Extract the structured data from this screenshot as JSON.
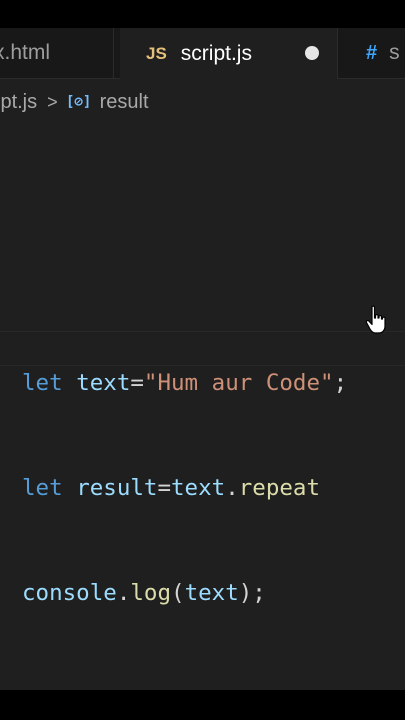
{
  "tabs": [
    {
      "label": "x.html",
      "active": false
    },
    {
      "label": "script.js",
      "icon": "JS",
      "active": true,
      "modified": true
    },
    {
      "label": "s",
      "icon": "#",
      "active": false
    }
  ],
  "breadcrumb": {
    "file": "ipt.js",
    "separator": ">",
    "symbol_icon": "[⊘]",
    "symbol": "result"
  },
  "code": {
    "line1": {
      "kw": "let",
      "name": "text",
      "eq": "=",
      "str": "\"Hum aur Code\"",
      "end": ";"
    },
    "line2": {
      "kw": "let",
      "name": "result",
      "eq": "=",
      "obj": "text",
      "dot": ".",
      "method": "repeat"
    },
    "line3": {
      "obj": "console",
      "dot": ".",
      "method": "log",
      "open": "(",
      "arg": "text",
      "close": ");"
    }
  },
  "colors": {
    "keyword": "#569cd6",
    "variable": "#9cdcfe",
    "string": "#ce9178",
    "function": "#dcdcaa",
    "js_icon": "#e5c07b",
    "css_icon": "#3fa6ff"
  }
}
